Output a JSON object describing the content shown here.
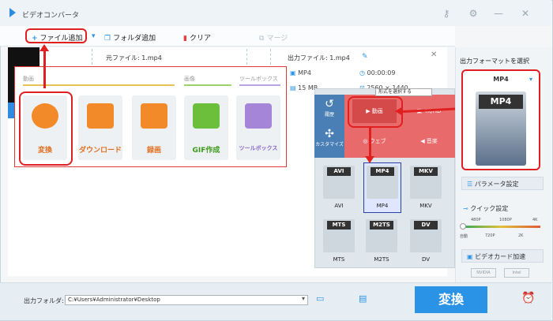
{
  "app": {
    "title": "ビデオコンバータ"
  },
  "toolbar": {
    "add_file": "ファイル追加",
    "add_folder": "フォルダ追加",
    "clear": "クリア",
    "merge": "マージ"
  },
  "file": {
    "source": "元ファイル: 1.mp4",
    "output": "出力ファイル: 1.mp4",
    "format": "MP4",
    "duration": "00:00:09",
    "size": "15 MB",
    "resolution": "2560 × 1440"
  },
  "menu": {
    "headers": [
      "動画",
      "画像",
      "ツールボックス"
    ],
    "tiles": [
      "変換",
      "ダウンロード",
      "録画",
      "GIF作成",
      "ツールボックス"
    ]
  },
  "format_picker": {
    "popup": "形式を選択する",
    "categories": [
      "履歴",
      "カスタマイズ"
    ],
    "top_buttons": [
      "動画",
      "4K/HD",
      "ウェブ",
      "音楽"
    ],
    "formats": [
      "AVI",
      "MP4",
      "MKV",
      "MTS",
      "M2TS",
      "DV"
    ],
    "selected": "MP4"
  },
  "right": {
    "label": "出力フォーマットを選択",
    "format": "MP4",
    "param": "パラメータ設定",
    "quick": "クイック設定",
    "ticks_top": [
      "480P",
      "1080P",
      "4K"
    ],
    "ticks_bottom": [
      "自動",
      "720P",
      "2K"
    ],
    "gpu": "ビデオカード加速",
    "gpu_brands": [
      "NVIDIA",
      "Intel"
    ]
  },
  "bottom": {
    "output_folder": "出力フォルダ:",
    "path": "C:¥Users¥Administrator¥Desktop",
    "convert": "変換"
  },
  "colors": {
    "accent": "#2a93e6",
    "annotation": "#e02020"
  }
}
